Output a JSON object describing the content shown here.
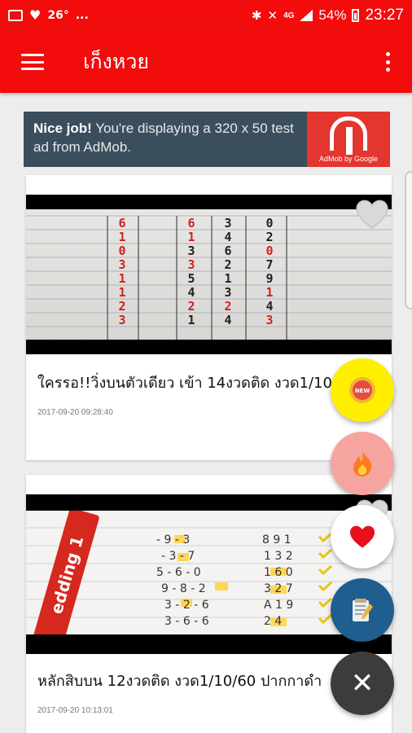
{
  "status_bar": {
    "temperature": "26°",
    "dots": "...",
    "network": "4G",
    "battery": "54%",
    "time": "23:27"
  },
  "app_bar": {
    "title": "เก็งหวย"
  },
  "ad": {
    "headline": "Nice job!",
    "body": " You're displaying a 320 x 50 test ad from AdMob.",
    "brand": "AdMob by Google"
  },
  "posts": [
    {
      "title": "ใครรอ!!วิ่งบนตัวเดียว เข้า 14งวดติด งวด1/10/60",
      "date": "2017-09-20 09:28:40",
      "grid_rows": [
        [
          "6",
          "6",
          "3",
          "0"
        ],
        [
          "1",
          "1",
          "4",
          "2"
        ],
        [
          "0",
          "3",
          "6",
          "0"
        ],
        [
          "3",
          "3",
          "2",
          "7"
        ],
        [
          "1",
          "5",
          "1",
          "9"
        ],
        [
          "1",
          "4",
          "3",
          "1"
        ],
        [
          "2",
          "2",
          "2",
          "4"
        ],
        [
          "3",
          "1",
          "4",
          "3"
        ]
      ]
    },
    {
      "title": "หลักสิบบน 12งวดติด งวด1/10/60 ปากกาดำ",
      "date": "2017-09-20 10:13:01",
      "marker_text": "edding 1"
    }
  ],
  "fab_new_label": "NEW",
  "colors": {
    "primary": "#f20c0c",
    "fab_new": "#ffee00",
    "fab_hot": "#f6a4a0",
    "fab_note": "#1f5e8e",
    "fab_close": "#3c3c3c"
  },
  "icons": [
    "menu-icon",
    "more-vert-icon",
    "heart-icon",
    "new-badge-icon",
    "fire-icon",
    "note-icon",
    "close-icon"
  ]
}
